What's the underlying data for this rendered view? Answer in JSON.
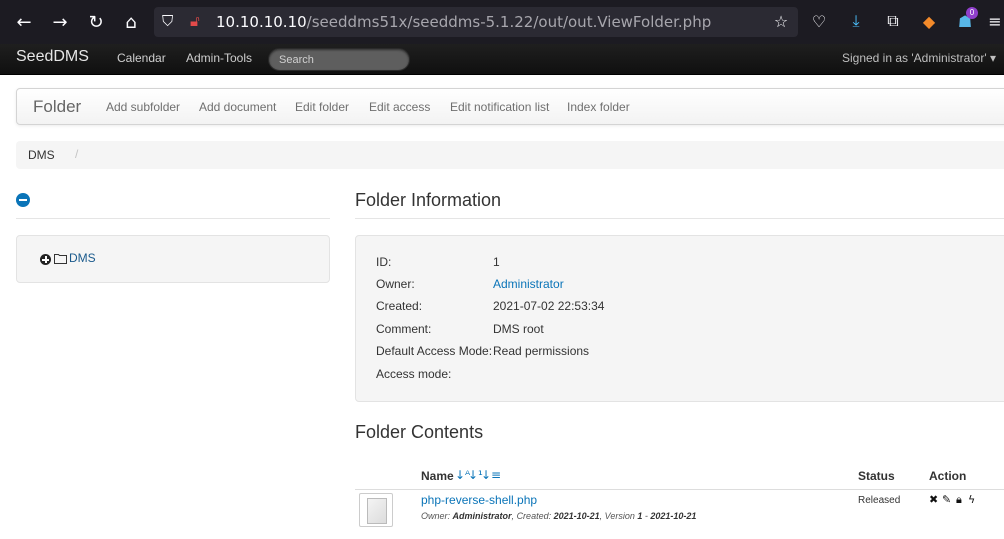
{
  "browser": {
    "url_host": "10.10.10.10",
    "url_path": "/seeddms51x/seeddms-5.1.22/out/out.ViewFolder.php",
    "icons": [
      "back-icon",
      "forward-icon",
      "reload-icon",
      "home-icon",
      "shield-icon",
      "lock-insecure-icon",
      "star-icon",
      "pocket-icon",
      "download-icon",
      "extensions-icon",
      "foxyproxy-icon",
      "ghostery-icon"
    ],
    "badge_count": "0"
  },
  "navbar": {
    "brand": "SeedDMS",
    "links": [
      "Calendar",
      "Admin-Tools"
    ],
    "search_placeholder": "Search",
    "signed_in": "Signed in as 'Administrator' ▾"
  },
  "folder_bar": {
    "title": "Folder",
    "actions": [
      "Add subfolder",
      "Add document",
      "Edit folder",
      "Edit access",
      "Edit notification list",
      "Index folder"
    ]
  },
  "breadcrumb": {
    "items": [
      "DMS"
    ],
    "separator": "/"
  },
  "tree": {
    "root_label": "DMS"
  },
  "folder_info": {
    "title": "Folder Information",
    "rows": [
      {
        "label": "ID:",
        "value": "1"
      },
      {
        "label": "Owner:",
        "value": "Administrator"
      },
      {
        "label": "Created:",
        "value": "2021-07-02 22:53:34"
      },
      {
        "label": "Comment:",
        "value": "DMS root"
      },
      {
        "label": "Default Access Mode:",
        "value": "Read permissions"
      },
      {
        "label": "Access mode:",
        "value": ""
      }
    ]
  },
  "folder_contents": {
    "title": "Folder Contents",
    "columns": [
      "Name",
      "Status",
      "Action"
    ],
    "documents": [
      {
        "name": "php-reverse-shell.php",
        "owner_label": "Owner:",
        "owner": "Administrator",
        "created_label": "Created:",
        "created": "2021-10-21",
        "version_label": "Version",
        "version": "1",
        "version_date": "2021-10-21",
        "status": "Released"
      }
    ]
  },
  "colors": {
    "link": "#0a74b8",
    "navbar_bg": "#141414",
    "browser_bg": "#1c1b22"
  }
}
